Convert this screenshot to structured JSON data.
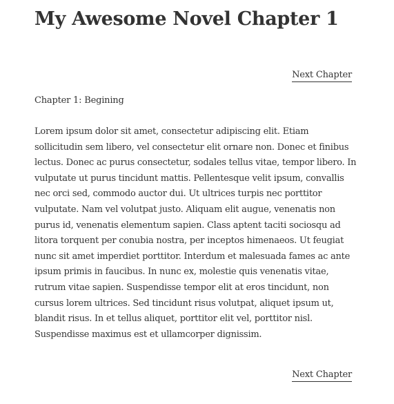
{
  "title": "My Awesome Novel Chapter 1",
  "next_chapter_top": "Next Chapter",
  "next_chapter_bottom": "Next Chapter",
  "chapter_heading": "Chapter 1: Begining",
  "body_lines": [
    "Lorem ipsum dolor sit amet, consectetur adipiscing elit. Etiam",
    "sollicitudin sem libero, vel consectetur elit ornare non. Donec et finibus",
    "lectus. Donec ac purus consectetur, sodales tellus vitae, tempor libero. In",
    "vulputate ut purus tincidunt mattis. Pellentesque velit ipsum, convallis",
    "nec orci sed, commodo auctor dui. Ut ultrices turpis nec porttitor",
    "vulputate. Nam vel volutpat justo. Aliquam elit augue, venenatis non",
    "purus id, venenatis elementum sapien. Class aptent taciti sociosqu ad",
    "litora torquent per conubia nostra, per inceptos himenaeos. Ut feugiat",
    "nunc sit amet imperdiet porttitor. Interdum et malesuada fames ac ante",
    "ipsum primis in faucibus. In nunc ex, molestie quis venenatis vitae,",
    "rutrum vitae sapien. Suspendisse tempor elit at eros tincidunt, non",
    "cursus lorem ultrices. Sed tincidunt risus volutpat, aliquet ipsum ut,",
    "blandit risus. In et tellus aliquet, porttitor elit vel, porttitor nisl.",
    "Suspendisse maximus est et ullamcorper dignissim."
  ]
}
